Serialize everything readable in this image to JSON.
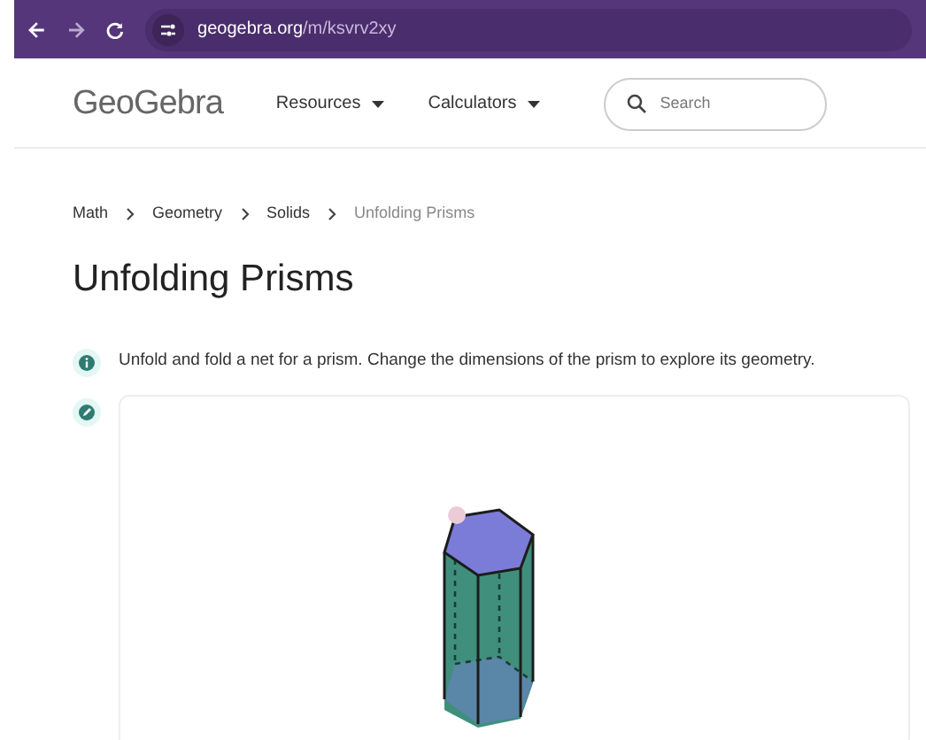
{
  "browser": {
    "url_host": "geogebra.org",
    "url_path": "/m/ksvrv2xy"
  },
  "header": {
    "logo": "GeoGebra",
    "nav": [
      {
        "label": "Resources"
      },
      {
        "label": "Calculators"
      }
    ],
    "search": {
      "placeholder": "Search"
    }
  },
  "breadcrumbs": [
    {
      "label": "Math",
      "current": false
    },
    {
      "label": "Geometry",
      "current": false
    },
    {
      "label": "Solids",
      "current": false
    },
    {
      "label": "Unfolding Prisms",
      "current": true
    }
  ],
  "title": "Unfolding Prisms",
  "description": "Unfold and fold a net for a prism. Change the dimensions of the prism to explore its geometry."
}
